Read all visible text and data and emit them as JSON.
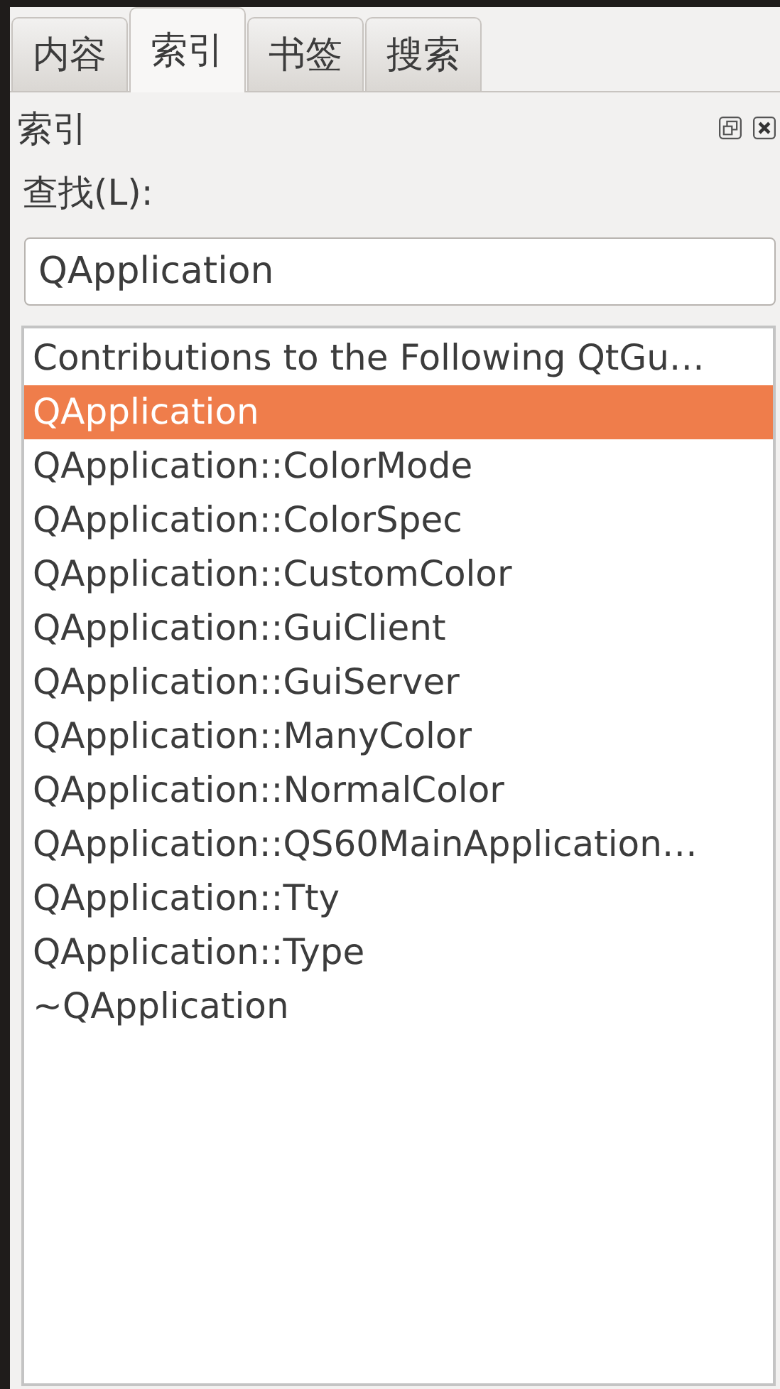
{
  "tabs": [
    {
      "label": "内容",
      "selected": false
    },
    {
      "label": "索引",
      "selected": true
    },
    {
      "label": "书签",
      "selected": false
    },
    {
      "label": "搜索",
      "selected": false
    }
  ],
  "panel": {
    "title": "索引"
  },
  "search": {
    "label": "查找(L):",
    "value": "QApplication"
  },
  "index_list": [
    {
      "label": "Contributions to the Following QtGu…",
      "selected": false
    },
    {
      "label": "QApplication",
      "selected": true
    },
    {
      "label": "QApplication::ColorMode",
      "selected": false
    },
    {
      "label": "QApplication::ColorSpec",
      "selected": false
    },
    {
      "label": "QApplication::CustomColor",
      "selected": false
    },
    {
      "label": "QApplication::GuiClient",
      "selected": false
    },
    {
      "label": "QApplication::GuiServer",
      "selected": false
    },
    {
      "label": "QApplication::ManyColor",
      "selected": false
    },
    {
      "label": "QApplication::NormalColor",
      "selected": false
    },
    {
      "label": "QApplication::QS60MainApplication…",
      "selected": false
    },
    {
      "label": "QApplication::Tty",
      "selected": false
    },
    {
      "label": "QApplication::Type",
      "selected": false
    },
    {
      "label": "~QApplication",
      "selected": false
    }
  ]
}
